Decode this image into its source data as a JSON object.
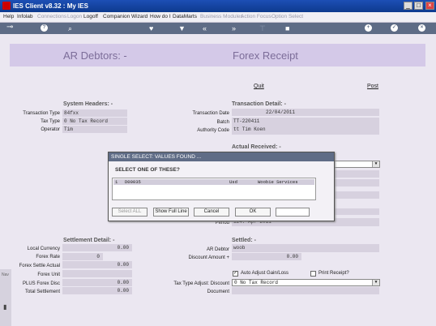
{
  "window": {
    "title": "IES Client v8.32 : My IES",
    "min": "_",
    "max": "□",
    "close": "×"
  },
  "menu": [
    {
      "label": "Help",
      "enabled": true
    },
    {
      "label": "Infolab",
      "enabled": true
    },
    {
      "label": "Connections",
      "enabled": false
    },
    {
      "label": "Logon",
      "enabled": false
    },
    {
      "label": "Logoff",
      "enabled": true
    },
    {
      "label": "Companion",
      "enabled": true
    },
    {
      "label": "Wizard",
      "enabled": true
    },
    {
      "label": "How do I",
      "enabled": true
    },
    {
      "label": "DataMarts",
      "enabled": true
    },
    {
      "label": "Business Modules",
      "enabled": false
    },
    {
      "label": "Action Focus",
      "enabled": false
    },
    {
      "label": "Option Select",
      "enabled": false
    }
  ],
  "toolbar": {
    "help": "?",
    "back": "«",
    "forward": "»",
    "plus": "+",
    "ok": "✓",
    "close": "×"
  },
  "header": {
    "left_title": "AR Debtors: -",
    "right_title": "Forex Receipt"
  },
  "actions": {
    "quit": "Quit",
    "post": "Post"
  },
  "system_headers": {
    "title": "System Headers: -",
    "transaction_type_label": "Transaction Type",
    "transaction_type": "84fxx",
    "tax_type_label": "Tax Type",
    "tax_type": "0 No Tax Record",
    "operator_label": "Operator",
    "operator": "Tim"
  },
  "transaction_detail": {
    "title": "Transaction Detail: -",
    "date_label": "Transaction Date",
    "date": "22/04/2011",
    "batch_label": "Batch",
    "batch": "TT-220411",
    "authority_label": "Authority Code",
    "authority": "tt Tim Koen"
  },
  "actual_received": {
    "title": "Actual Received: -"
  },
  "period": {
    "label": "Period",
    "value": "124: Apr 2011"
  },
  "settlement_detail": {
    "title": "Settlement Detail: -",
    "local_currency_label": "Local Currency",
    "local_currency": "0.00",
    "forex_rate_label": "Forex Rate",
    "forex_rate": "0",
    "forex_settle_actual_label": "Forex Settle Actual",
    "forex_settle_actual": "0.00",
    "forex_unit_label": "Forex Unit",
    "forex_unit": "",
    "plus_forex_disc_label": "PLUS Forex Disc",
    "plus_forex_disc": "0.00",
    "total_settlement_label": "Total Settlement",
    "total_settlement": "0.00"
  },
  "settled": {
    "title": "Settled: -",
    "ar_debtor_label": "AR Debtor",
    "ar_debtor": "woob",
    "discount_amount_label": "Discount Amount +",
    "discount_amount": "0.00",
    "auto_adjust_label": "Auto Adjust Gain/Loss",
    "auto_adjust_checked": true,
    "print_receipt_label": "Print Receipt?",
    "print_receipt_checked": false,
    "tax_type_adjust_label": "Tax Type Adjust: Discount",
    "tax_type_adjust": "0 No Tax Record",
    "document_label": "Document",
    "document": ""
  },
  "dialog": {
    "title": "SINGLE SELECT: VALUES FOUND ...",
    "prompt": "SELECT ONE OF THESE?",
    "rows": [
      {
        "num": "1",
        "code": "D00035",
        "currency": "Usd",
        "name": "Woobie Services"
      }
    ],
    "buttons": {
      "select_all": "Select ALL",
      "show_full_line": "Show Full Line",
      "cancel": "Cancel",
      "ok": "OK"
    },
    "input_value": ""
  },
  "left_strip": {
    "label": "Nav"
  }
}
